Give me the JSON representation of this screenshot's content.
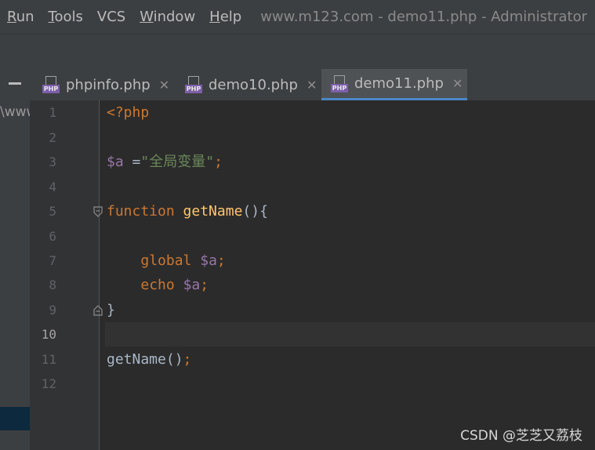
{
  "menu": {
    "items": [
      {
        "mnemonic": "R",
        "rest": "un"
      },
      {
        "mnemonic": "T",
        "rest": "ools"
      },
      {
        "mnemonic": "",
        "rest": "VCS"
      },
      {
        "mnemonic": "W",
        "rest": "indow"
      },
      {
        "mnemonic": "H",
        "rest": "elp"
      }
    ]
  },
  "window_title": "www.m123.com - demo11.php - Administrator",
  "project_panel": {
    "path_fragment": "\\www"
  },
  "tabs": [
    {
      "label": "phpinfo.php",
      "icon": "php-file-icon",
      "icon_label": "PHP",
      "active": false
    },
    {
      "label": "demo10.php",
      "icon": "php-file-icon",
      "icon_label": "PHP",
      "active": false
    },
    {
      "label": "demo11.php",
      "icon": "php-file-icon",
      "icon_label": "PHP",
      "active": true
    }
  ],
  "tab_close_glyph": "✕",
  "editor": {
    "current_line": 10,
    "line_numbers": [
      "1",
      "2",
      "3",
      "4",
      "5",
      "6",
      "7",
      "8",
      "9",
      "10",
      "11",
      "12"
    ],
    "lines": [
      {
        "text": "<?php"
      },
      {
        "text": ""
      },
      {
        "text": "$a =\"全局变量\";"
      },
      {
        "text": ""
      },
      {
        "text": "function getName(){"
      },
      {
        "text": ""
      },
      {
        "text": "    global $a;"
      },
      {
        "text": "    echo $a;"
      },
      {
        "text": "}"
      },
      {
        "text": ""
      },
      {
        "text": "getName();"
      },
      {
        "text": ""
      }
    ],
    "tokens": {
      "l1_open": "<?php",
      "l3_var": "$a",
      "l3_eq": " =",
      "l3_str": "\"全局变量\"",
      "l3_semi": ";",
      "l5_kw": "function",
      "l5_fn": "getName",
      "l5_rest": "(){",
      "l7_kw": "global",
      "l7_var": "$a",
      "l7_semi": ";",
      "l8_kw": "echo",
      "l8_var": "$a",
      "l8_semi": ";",
      "l9_brace": "}",
      "l11_fn": "getName",
      "l11_paren": "()",
      "l11_semi": ";"
    }
  },
  "watermark": "CSDN @芝芝又荔枝",
  "colors": {
    "keyword": "#cc7832",
    "variable": "#9876aa",
    "string": "#6a8759",
    "function_decl": "#ffc66d",
    "default_text": "#a9b7c6",
    "active_tab_underline": "#4a88c7"
  }
}
